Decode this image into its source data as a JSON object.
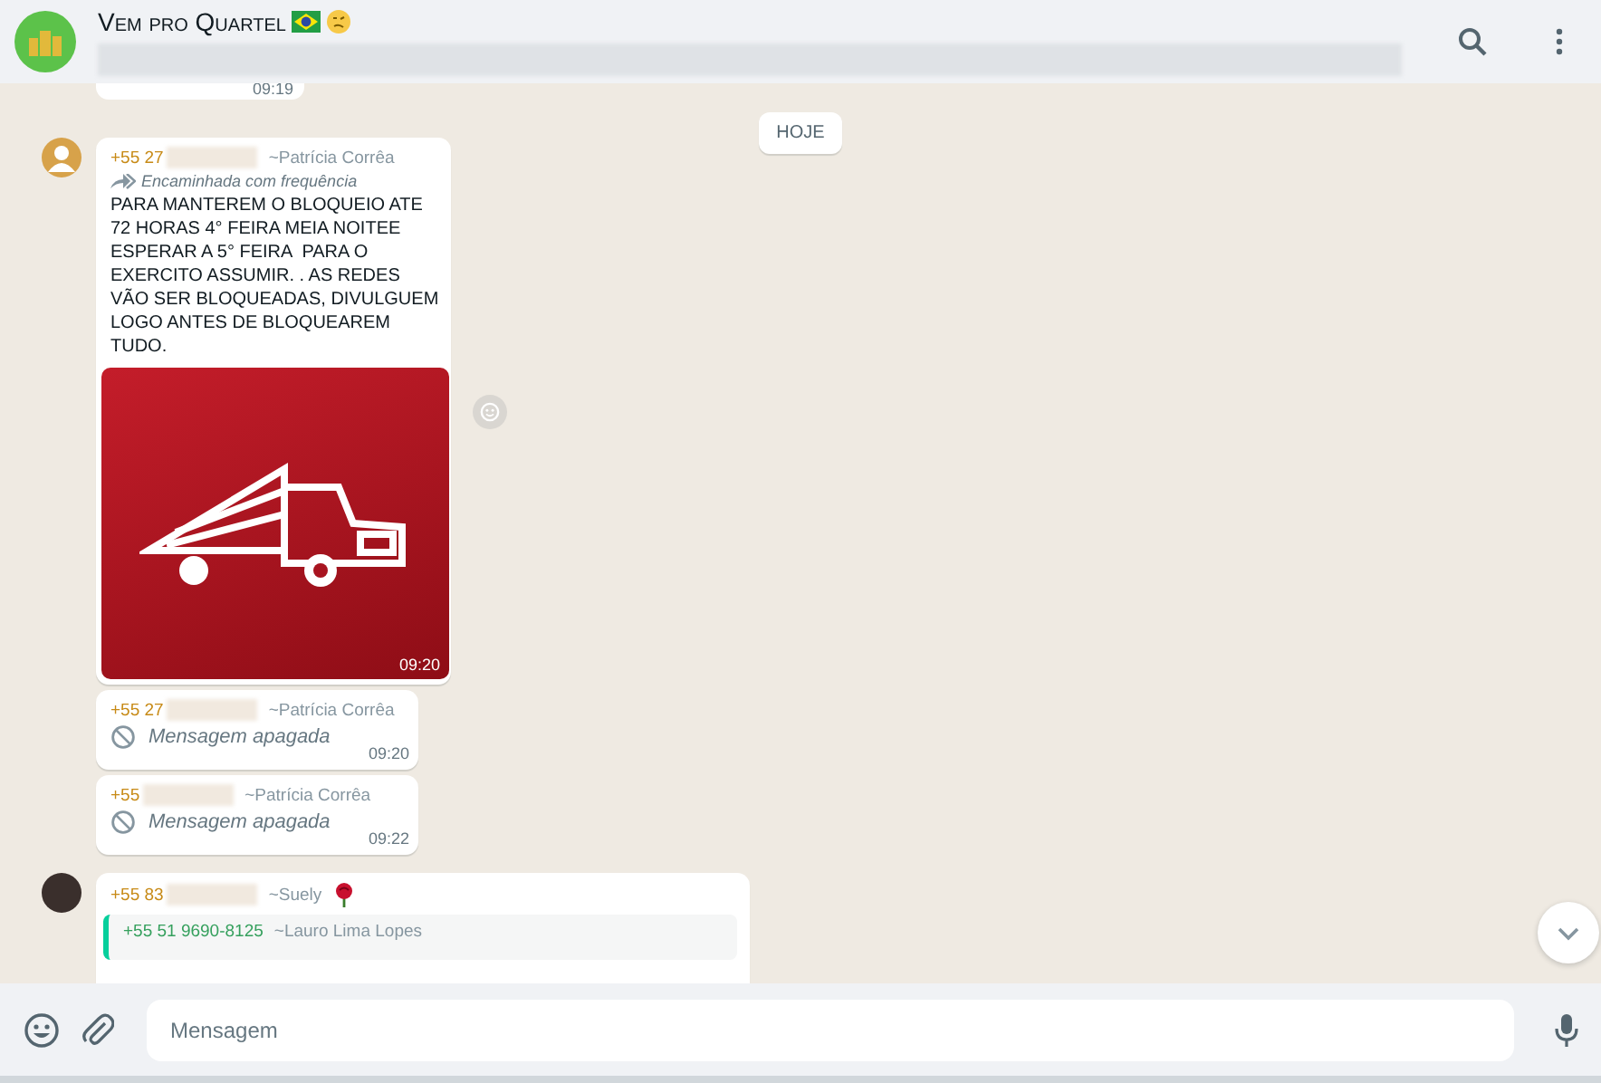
{
  "header": {
    "title": "Vem pro Quartel"
  },
  "messages": [
    {
      "kind": "partial",
      "time": "09:19"
    },
    {
      "kind": "date",
      "text": "HOJE"
    },
    {
      "kind": "forwarded",
      "phone": "+55 27",
      "sender": "~Patrícia Corrêa",
      "forward_label": "Encaminhada com frequência",
      "text": "PARA MANTEREM O BLOQUEIO ATE 72 HORAS 4° FEIRA MEIA NOITEE ESPERAR A 5° FEIRA  PARA O EXERCITO ASSUMIR. . AS REDES VÃO SER BLOQUEADAS, DIVULGUEM LOGO ANTES DE BLOQUEAREM TUDO.",
      "time": "09:20"
    },
    {
      "kind": "deleted",
      "phone": "+55 27",
      "sender": "~Patrícia Corrêa",
      "text": "Mensagem apagada",
      "time": "09:20"
    },
    {
      "kind": "deleted",
      "phone": "+55",
      "sender": "~Patrícia Corrêa",
      "text": "Mensagem apagada",
      "time": "09:22"
    },
    {
      "kind": "reply",
      "phone": "+55 83",
      "sender": "~Suely",
      "quote_phone": "+55 51 9690-8125",
      "quote_sender": "~Lauro Lima Lopes"
    }
  ],
  "composer": {
    "placeholder": "Mensagem"
  }
}
